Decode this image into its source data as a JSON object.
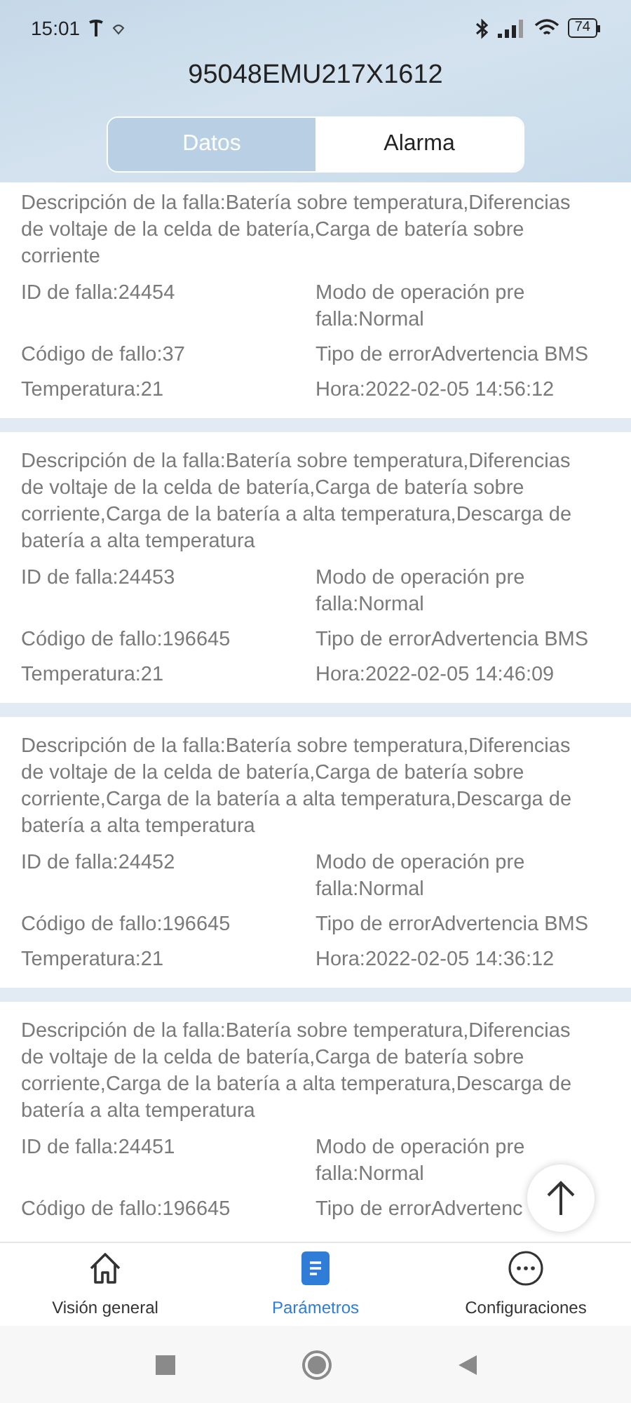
{
  "status_bar": {
    "time": "15:01",
    "battery": "74"
  },
  "title": "95048EMU217X1612",
  "tabs": [
    {
      "label": "Datos",
      "selected": false
    },
    {
      "label": "Alarma",
      "selected": true
    }
  ],
  "alarms": [
    {
      "description": "Descripción de la falla:Batería sobre temperatura,Diferencias de voltaje de la celda de batería,Carga de batería sobre corriente",
      "fields": [
        "ID de falla:24454",
        "Modo de operación pre falla:Normal",
        "Código de fallo:37",
        "Tipo de errorAdvertencia BMS",
        "Temperatura:21",
        "Hora:2022-02-05 14:56:12"
      ]
    },
    {
      "description": "Descripción de la falla:Batería sobre temperatura,Diferencias de voltaje de la celda de batería,Carga de batería sobre corriente,Carga de la batería a alta temperatura,Descarga de batería a alta temperatura",
      "fields": [
        "ID de falla:24453",
        "Modo de operación pre falla:Normal",
        "Código de fallo:196645",
        "Tipo de errorAdvertencia BMS",
        "Temperatura:21",
        "Hora:2022-02-05 14:46:09"
      ]
    },
    {
      "description": "Descripción de la falla:Batería sobre temperatura,Diferencias de voltaje de la celda de batería,Carga de batería sobre corriente,Carga de la batería a alta temperatura,Descarga de batería a alta temperatura",
      "fields": [
        "ID de falla:24452",
        "Modo de operación pre falla:Normal",
        "Código de fallo:196645",
        "Tipo de errorAdvertencia BMS",
        "Temperatura:21",
        "Hora:2022-02-05 14:36:12"
      ]
    },
    {
      "description": "Descripción de la falla:Batería sobre temperatura,Diferencias de voltaje de la celda de batería,Carga de batería sobre corriente,Carga de la batería a alta temperatura,Descarga de batería a alta temperatura",
      "fields": [
        "ID de falla:24451",
        "Modo de operación pre falla:Normal",
        "Código de fallo:196645",
        "Tipo de errorAdvertenc"
      ]
    }
  ],
  "bottom_nav": [
    {
      "label": "Visión general",
      "kind": "home",
      "selected": false
    },
    {
      "label": "Parámetros",
      "kind": "document",
      "selected": true
    },
    {
      "label": "Configuraciones",
      "kind": "more",
      "selected": false
    }
  ]
}
